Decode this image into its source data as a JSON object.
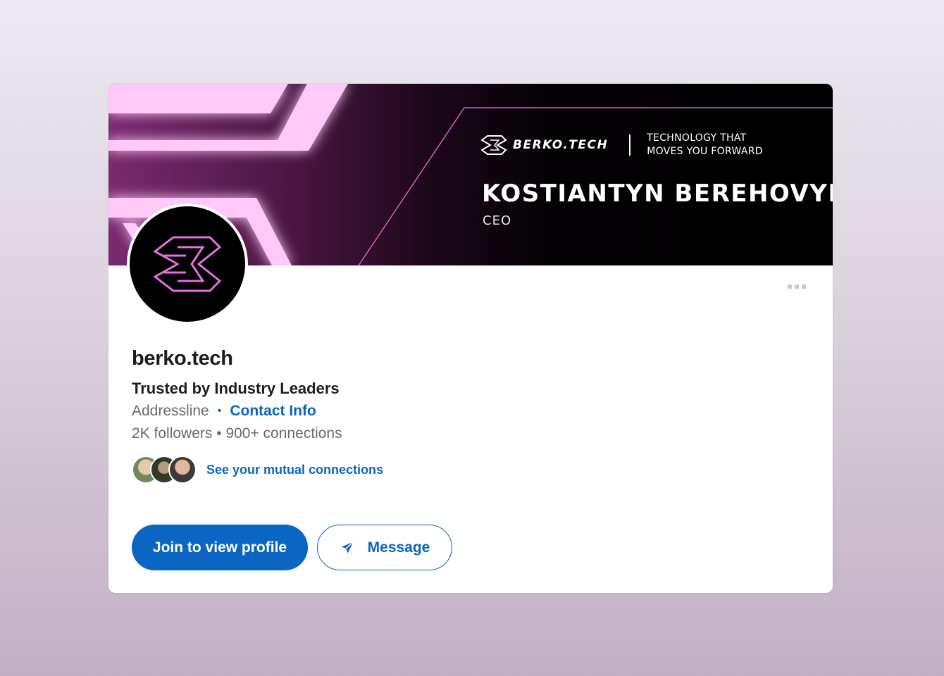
{
  "banner": {
    "brand_name": "BERKO.TECH",
    "tagline": "TECHNOLOGY THAT MOVES YOU FORWARD",
    "person_name": "KOSTIANTYN BEREHOVYI",
    "role": "CEO"
  },
  "profile": {
    "name": "berko.tech",
    "headline": "Trusted by Industry Leaders",
    "location": "Addressline",
    "separator": "•",
    "contact_label": "Contact Info",
    "stats": "2K followers • 900+ connections",
    "mutual_label": "See your mutual connections"
  },
  "actions": {
    "primary_label": "Join to view profile",
    "secondary_label": "Message",
    "secondary_icon": "send-icon",
    "more_icon": "more-options-icon"
  },
  "colors": {
    "link_blue": "#0a66c2",
    "accent_pink": "#ff6ef0",
    "banner_dark": "#000000"
  }
}
